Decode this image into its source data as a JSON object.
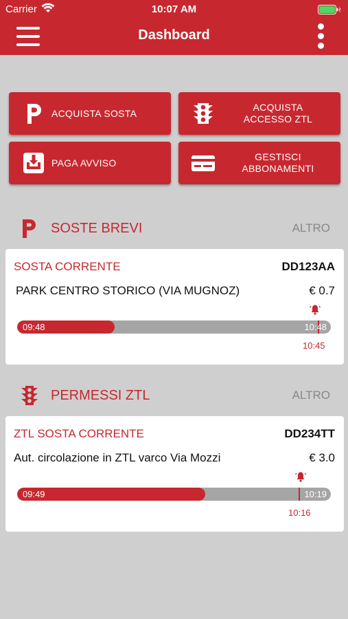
{
  "status_bar": {
    "carrier": "Carrier",
    "time": "10:07 AM",
    "wifi_icon": "wifi-icon",
    "battery_icon": "battery-icon",
    "charging_icon": "charging-bolt-icon"
  },
  "header": {
    "title": "Dashboard",
    "menu_icon": "hamburger-menu-icon",
    "more_icon": "more-vertical-icon"
  },
  "actions": [
    {
      "label": "ACQUISTA SOSTA",
      "icon": "parking-icon"
    },
    {
      "label_line1": "ACQUISTA",
      "label_line2": "ACCESSO ZTL",
      "icon": "traffic-light-icon"
    },
    {
      "label": "PAGA AVVISO",
      "icon": "download-box-icon"
    },
    {
      "label_line1": "GESTISCI",
      "label_line2": "ABBONAMENTI",
      "icon": "card-icon"
    }
  ],
  "soste": {
    "title": "SOSTE BREVI",
    "more_label": "ALTRO",
    "icon": "parking-icon",
    "card": {
      "title": "SOSTA CORRENTE",
      "plate": "DD123AA",
      "location": "PARK CENTRO STORICO (VIA MUGNOZ)",
      "price": "€ 0.7",
      "start_time": "09:48",
      "end_time": "10:48",
      "alarm_time": "10:45",
      "progress": 0.31,
      "alarm_position": 0.96,
      "bell_icon": "alarm-bell-icon"
    }
  },
  "ztl": {
    "title": "PERMESSI ZTL",
    "more_label": "ALTRO",
    "icon": "traffic-light-icon",
    "card": {
      "title": "ZTL SOSTA CORRENTE",
      "plate": "DD234TT",
      "location": "Aut.  circolazione in ZTL varco Via Mozzi",
      "price": "€ 3.0",
      "start_time": "09:49",
      "end_time": "10:19",
      "alarm_time": "10:16",
      "progress": 0.6,
      "alarm_position": 0.9,
      "bell_icon": "alarm-bell-icon"
    }
  },
  "colors": {
    "brand": "#c7282f",
    "background": "#cfcfcf",
    "track": "#a5a5a5",
    "muted_text": "#888888"
  }
}
